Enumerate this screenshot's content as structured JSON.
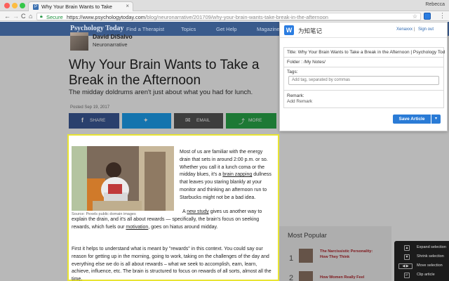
{
  "browser": {
    "tab_title": "Why Your Brain Wants to Take",
    "tab_close": "×",
    "profile_name": "Rebecca",
    "secure_label": "Secure",
    "url_host": "https://www.psychologytoday.com",
    "url_path": "/blog/neuronarrative/201709/why-your-brain-wants-take-break-in-the-afternoon",
    "nav_back": "←",
    "nav_forward": "→",
    "nav_reload": "C",
    "nav_home": "⌂",
    "bookmark_star": "☆",
    "menu_dots": "⋮"
  },
  "site": {
    "logo": "Psychology Today",
    "nav": [
      "Find a Therapist",
      "Topics",
      "Get Help",
      "Magazine"
    ]
  },
  "article": {
    "author_name": "David DiSalvo",
    "blog_name": "Neuronarrative",
    "headline": "Why Your Brain Wants to Take a Break in the Afternoon",
    "subhead": "The midday doldrums aren't just about what you had for lunch.",
    "posted": "Posted Sep 19, 2017",
    "share": {
      "facebook": "SHARE",
      "email": "EMAIL",
      "more": "MORE"
    },
    "photo_caption": "Source: Pexels public domain images",
    "p1_a": "Most of us are familiar with the energy drain that sets in around 2:00 p.m. or so. Whether you call it a lunch coma or the midday blues, it's a ",
    "p1_link": "brain zapping",
    "p1_b": " dullness that leaves you staring blankly at your monitor and thinking an afternoon run to Starbucks might not be a bad idea.",
    "p2_a": "A ",
    "p2_link": "new study",
    "p2_b": " gives us another way to explain the drain, and it's all about rewards — specifically, the brain's focus on seeking rewards, which fuels our ",
    "p2_link2": "motivation",
    "p2_c": ", goes on hiatus around midday.",
    "p3": "First it helps to understand what is meant by \"rewards\" in this context. You could say our reason for getting up in the morning, going to work, taking on the challenges of the day and everything else we do is all about rewards – what we seek to accomplish, earn, learn, achieve, influence, etc. The brain is structured to focus on rewards of all sorts, almost all the time."
  },
  "popular": {
    "title": "Most Popular",
    "items": [
      {
        "num": "1",
        "title": "The Narcissistic Personality: How They Think"
      },
      {
        "num": "2",
        "title": "How Women Really Feel"
      }
    ]
  },
  "clip_toolbar": {
    "rows": [
      {
        "key": "▲",
        "label": "Expand selection"
      },
      {
        "key": "▼",
        "label": "Shrink selection"
      },
      {
        "key": "◀ ▶",
        "label": "Move selection"
      },
      {
        "key": "↵",
        "label": "Clip article"
      }
    ]
  },
  "clipper": {
    "app_name": "为知笔记",
    "user": "Xenaxxx",
    "separator": "|",
    "sign_out": "Sign out",
    "title_field": "Title: Why Your Brain Wants to Take a Break in the Afternoon | Psychology Today",
    "folder_field": "Folder : /My Notes/",
    "tags_label": "Tags:",
    "tags_placeholder": "Add tag, separated by commas",
    "remark_label": "Remark:",
    "remark_placeholder": "Add Remark",
    "save_label": "Save Article",
    "save_caret": "▾",
    "accent_color": "#2a7bd6"
  }
}
